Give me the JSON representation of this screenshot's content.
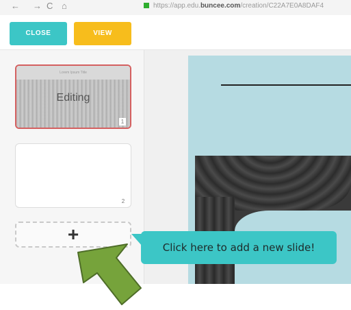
{
  "browser": {
    "back": "←",
    "forward": "→",
    "reload": "C",
    "home": "⌂",
    "url_prefix": "https://app.edu.",
    "url_domain": "buncee.com",
    "url_path": "/creation/C22A7E0A8DAF4"
  },
  "toolbar": {
    "close_label": "CLOSE",
    "view_label": "VIEW",
    "close_color": "#3cc6c6",
    "view_color": "#f7bd1c"
  },
  "slides": [
    {
      "header": "Lorem Ipsum Title",
      "title": "Editing",
      "number": "1"
    },
    {
      "number": "2"
    }
  ],
  "add_slide": {
    "icon": "+"
  },
  "tooltip": {
    "text": "Click here to add a new slide!"
  },
  "colors": {
    "accent": "#3cc6c6",
    "selection": "#d46060",
    "arrow": "#76a33b"
  }
}
